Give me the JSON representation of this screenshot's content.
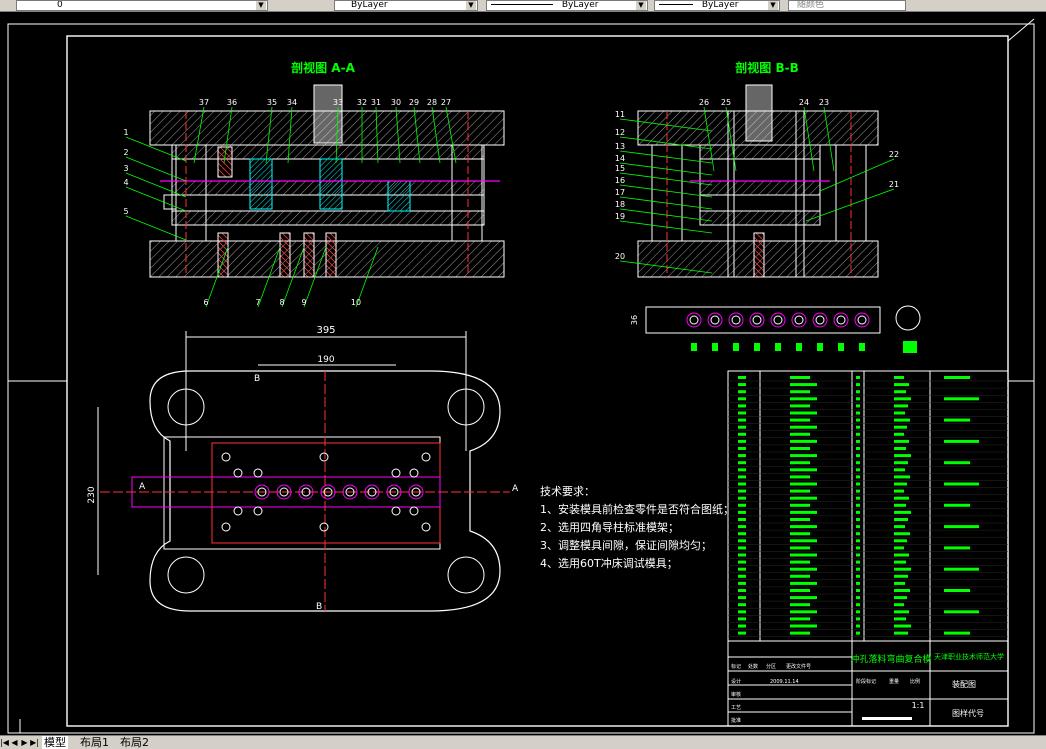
{
  "toolbar": {
    "layer_value": "0",
    "color_value": "ByLayer",
    "linetype_value": "ByLayer",
    "lineweight_value": "ByLayer",
    "plotstyle_value": "随颜色"
  },
  "drawing": {
    "section_aa_title": "剖视图  A-A",
    "section_bb_title": "剖视图  B-B",
    "dim_395": "395",
    "dim_190": "190",
    "dim_230": "230",
    "dim_strip": "36",
    "label_a_left": "A",
    "label_a_right": "A",
    "label_b_top": "B",
    "label_b_bottom": "B",
    "aa_top_labels": [
      "37",
      "36",
      "35",
      "34",
      "33",
      "32",
      "31",
      "30",
      "29",
      "28",
      "27"
    ],
    "aa_left_labels": [
      "1",
      "2",
      "3",
      "4",
      "5"
    ],
    "aa_bottom_labels": [
      "6",
      "7",
      "8",
      "9",
      "10"
    ],
    "bb_left_labels": [
      "11",
      "12",
      "13",
      "14",
      "15",
      "16",
      "17",
      "18",
      "19",
      "20"
    ],
    "bb_top_labels": [
      "26",
      "25",
      "24",
      "23"
    ],
    "bb_right_labels": [
      "22",
      "21"
    ],
    "tech_title": "技术要求：",
    "tech_items": [
      "1、安装模具前检查零件是否符合图纸；",
      "2、选用四角导柱标准模架；",
      "3、调整模具间隙，保证间隙均匀；",
      "4、选用60T冲床调试模具；"
    ],
    "title_block_name": "冲孔落料弯曲复合模",
    "school": "天津职业技术师范大学",
    "drawing_type": "装配图",
    "drawing_code": "图样代号",
    "scale": "1:1",
    "date": "2009.11.14",
    "row_labels": [
      "设计",
      "审核",
      "工艺",
      "批准"
    ],
    "sign_labels": [
      "标记",
      "处数",
      "分区",
      "更改文件号"
    ],
    "stage_labels": [
      "阶段标记",
      "重量",
      "比例"
    ]
  },
  "tabs": {
    "model": "模型",
    "layout1": "布局1",
    "layout2": "布局2"
  }
}
